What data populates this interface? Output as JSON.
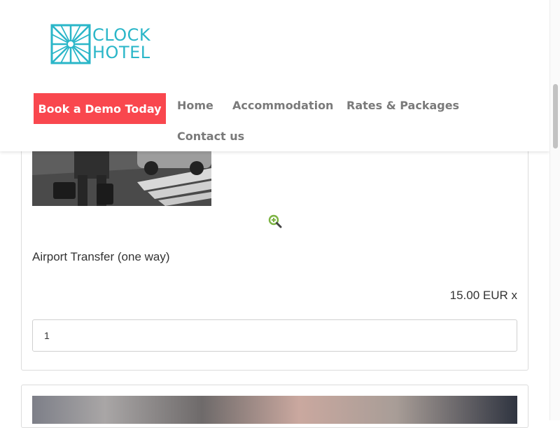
{
  "header": {
    "logo": {
      "line1": "CLOCK",
      "line2": "HOTEL"
    },
    "cta_label": "Book a Demo Today",
    "nav": [
      {
        "label": "Home"
      },
      {
        "label": "Accommodation"
      },
      {
        "label": "Rates & Packages"
      },
      {
        "label": "Contact us"
      }
    ]
  },
  "extra": {
    "title": "Airport Transfer (one way)",
    "price": "15.00 EUR x",
    "quantity": "1"
  },
  "colors": {
    "brand": "#2ab6c8",
    "cta": "#f9474e",
    "zoom_icon": "#7cb342",
    "nav_text": "#7a7a7a"
  },
  "icons": {
    "zoom": "zoom-in-icon",
    "logo": "snowflake-logo-icon"
  }
}
